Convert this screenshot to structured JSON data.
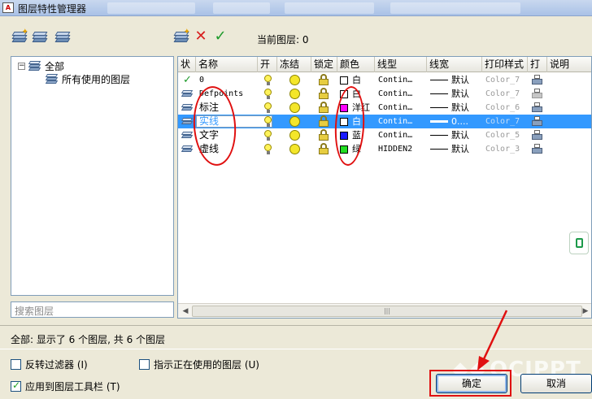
{
  "window": {
    "title": "图层特性管理器",
    "app_icon_text": "A"
  },
  "toolbar": {
    "current_layer_label": "当前图层: 0"
  },
  "tree": {
    "root_label": "全部",
    "child_label": "所有使用的图层"
  },
  "search": {
    "placeholder": "搜索图层"
  },
  "grid": {
    "columns": [
      "状",
      "名称",
      "开",
      "冻结",
      "锁定",
      "颜色",
      "线型",
      "线宽",
      "打印样式",
      "打",
      "说明"
    ],
    "rows": [
      {
        "status": "current",
        "name": "0",
        "on": true,
        "frozen": false,
        "locked": false,
        "color_hex": "#ffffff",
        "color_name": "白",
        "linetype": "Contin…",
        "lineweight": "默认",
        "plot_style": "Color_7",
        "plot": true,
        "selected": false
      },
      {
        "status": "",
        "name": "Defpoints",
        "on": true,
        "frozen": false,
        "locked": false,
        "color_hex": "#ffffff",
        "color_name": "白",
        "linetype": "Contin…",
        "lineweight": "默认",
        "plot_style": "Color_7",
        "plot": false,
        "selected": false
      },
      {
        "status": "",
        "name": "标注",
        "on": true,
        "frozen": false,
        "locked": false,
        "color_hex": "#ff00ff",
        "color_name": "洋红",
        "linetype": "Contin…",
        "lineweight": "默认",
        "plot_style": "Color_6",
        "plot": true,
        "selected": false
      },
      {
        "status": "",
        "name": "实线",
        "on": true,
        "frozen": false,
        "locked": false,
        "color_hex": "#ffffff",
        "color_name": "白",
        "linetype": "Contin…",
        "lineweight": "0....",
        "plot_style": "Color_7",
        "plot": true,
        "selected": true
      },
      {
        "status": "",
        "name": "文字",
        "on": true,
        "frozen": false,
        "locked": false,
        "color_hex": "#1a1aff",
        "color_name": "蓝",
        "linetype": "Contin…",
        "lineweight": "默认",
        "plot_style": "Color_5",
        "plot": true,
        "selected": false
      },
      {
        "status": "",
        "name": "虚线",
        "on": true,
        "frozen": false,
        "locked": false,
        "color_hex": "#22dd22",
        "color_name": "绿",
        "linetype": "HIDDEN2",
        "lineweight": "默认",
        "plot_style": "Color_3",
        "plot": true,
        "selected": false
      }
    ]
  },
  "status": {
    "text": "全部: 显示了 6 个图层, 共 6 个图层"
  },
  "options": {
    "invert_filter": {
      "label": "反转过滤器 (I)",
      "checked": false
    },
    "indicate_in_use": {
      "label": "指示正在使用的图层 (U)",
      "checked": false
    },
    "apply_to_toolbar": {
      "label": "应用到图层工具栏 (T)",
      "checked": true
    }
  },
  "buttons": {
    "ok": "确定",
    "cancel": "取消"
  },
  "watermark": {
    "mark": "◆◆",
    "brand": "OCIPPT"
  },
  "colors": {
    "selection": "#3399ff",
    "annotation_red": "#e01010"
  }
}
